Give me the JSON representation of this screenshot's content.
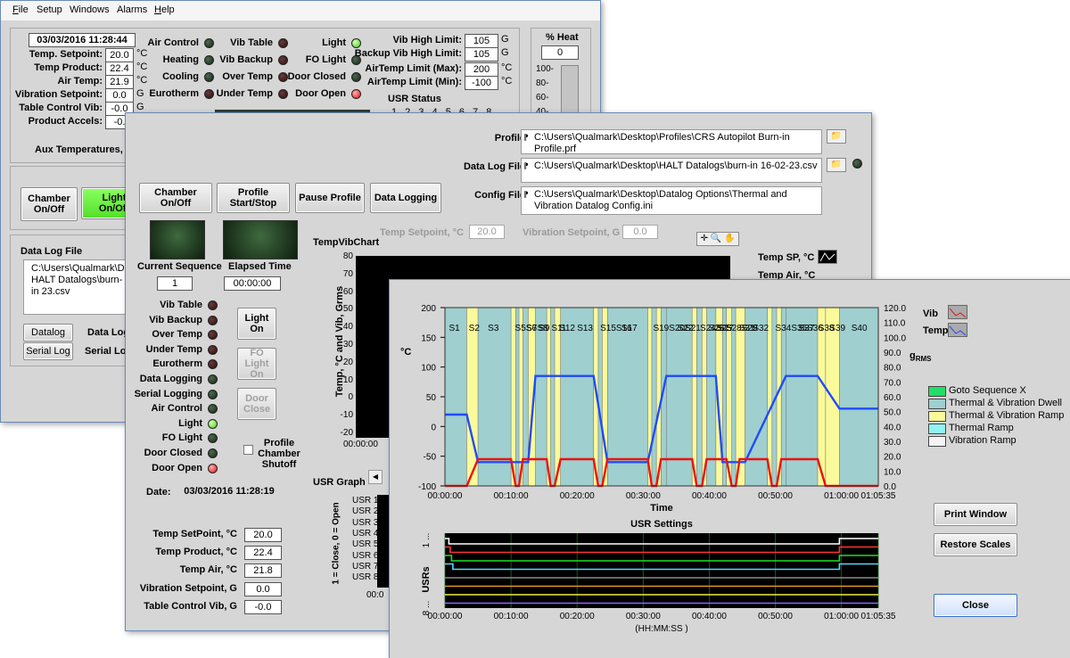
{
  "win1": {
    "menu": [
      "File",
      "Setup",
      "Windows",
      "Alarms",
      "Help"
    ],
    "datetime": "03/03/2016 11:28:44",
    "readouts": [
      {
        "label": "Temp. Setpoint:",
        "value": "20.0",
        "unit": "°C"
      },
      {
        "label": "Temp Product:",
        "value": "22.4",
        "unit": "°C"
      },
      {
        "label": "Air Temp:",
        "value": "21.9",
        "unit": "°C"
      },
      {
        "label": "Vibration Setpoint:",
        "value": "0.0",
        "unit": "G"
      },
      {
        "label": "Table Control Vib:",
        "value": "-0.0",
        "unit": "G"
      },
      {
        "label": "Product Accels:",
        "value": "-0.",
        "unit": ""
      }
    ],
    "aux_label": "Aux Temperatures, °C",
    "leds_col1": [
      {
        "label": "Air Control",
        "state": "offg"
      },
      {
        "label": "Heating",
        "state": "offg"
      },
      {
        "label": "Cooling",
        "state": "offg"
      },
      {
        "label": "Eurotherm",
        "state": "off"
      }
    ],
    "leds_col2": [
      {
        "label": "Vib Table",
        "state": "off"
      },
      {
        "label": "Vib Backup",
        "state": "off"
      },
      {
        "label": "Over Temp",
        "state": "off"
      },
      {
        "label": "Under Temp",
        "state": "off"
      }
    ],
    "leds_col3": [
      {
        "label": "Light",
        "state": "green"
      },
      {
        "label": "FO Light",
        "state": "offg"
      },
      {
        "label": "Door Closed",
        "state": "offg"
      },
      {
        "label": "Door Open",
        "state": "red"
      }
    ],
    "limits": [
      {
        "label": "Vib High Limit:",
        "value": "105",
        "unit": "G"
      },
      {
        "label": "Backup Vib High Limit:",
        "value": "105",
        "unit": "G"
      },
      {
        "label": "AirTemp Limit (Max):",
        "value": "200",
        "unit": "°C"
      },
      {
        "label": "AirTemp Limit (Min):",
        "value": "-100",
        "unit": "°C"
      }
    ],
    "usr_status": "USR Status",
    "usr_numbers": "1 2 3 4 5 6 7 8",
    "heat_label": "% Heat",
    "heat_value": "0",
    "heat_ticks": [
      "100-",
      "80-",
      "60-",
      "40-"
    ],
    "btn_chamber": "Chamber On/Off",
    "btn_light": "Light On/Off",
    "datalog_title": "Data Log File",
    "datalog_path": "C:\\Users\\Qualmark\\Desk HALT Datalogs\\burn-in 23.csv",
    "btn_datalog": "Datalog",
    "btn_seriallog": "Serial Log",
    "datalog_side": "Data Log",
    "seriallog_side": "Serial Log"
  },
  "win2": {
    "buttons": [
      "Chamber On/Off",
      "Profile Start/Stop",
      "Pause Profile",
      "Data Logging"
    ],
    "profile_label": "Profile",
    "profile_path": "C:\\Users\\Qualmark\\Desktop\\Profiles\\CRS Autopilot Burn-in Profile.prf",
    "datalog_label": "Data Log File",
    "datalog_path": "C:\\Users\\Qualmark\\Desktop\\HALT Datalogs\\burn-in 16-02-23.csv",
    "config_label": "Config File",
    "config_path": "C:\\Users\\Qualmark\\Desktop\\Datalog Options\\Thermal and Vibration Datalog Config.ini",
    "temp_setpoint_label": "Temp Setpoint, °C",
    "temp_setpoint_value": "20.0",
    "vib_setpoint_label": "Vibration Setpoint, G",
    "vib_setpoint_value": "0.0",
    "current_sequence_label": "Current Sequence",
    "current_sequence_value": "1",
    "elapsed_label": "Elapsed Time",
    "elapsed_value": "00:00:00",
    "chart_title": "TempVibChart",
    "chart_ylabel": "Temp, °C and Vib, Grms",
    "chart_yticks": [
      "80",
      "70",
      "60",
      "50",
      "40",
      "30",
      "20",
      "10",
      "0",
      "-10",
      "-20"
    ],
    "chart_xtick": "00:00:00",
    "legend": [
      "Temp SP, °C",
      "Temp Air, °C"
    ],
    "leds": [
      {
        "label": "Vib Table",
        "state": "off"
      },
      {
        "label": "Vib Backup",
        "state": "off"
      },
      {
        "label": "Over Temp",
        "state": "off"
      },
      {
        "label": "Under Temp",
        "state": "off"
      },
      {
        "label": "Eurotherm",
        "state": "off"
      },
      {
        "label": "Data Logging",
        "state": "offg"
      },
      {
        "label": "Serial Logging",
        "state": "offg"
      },
      {
        "label": "Air Control",
        "state": "offg"
      },
      {
        "label": "Light",
        "state": "green"
      },
      {
        "label": "FO Light",
        "state": "offg"
      },
      {
        "label": "Door Closed",
        "state": "offg"
      },
      {
        "label": "Door Open",
        "state": "red"
      }
    ],
    "light_btn": "Light On",
    "fo_light_btn": "FO Light On",
    "door_btn": "Door Close",
    "profile_shutoff": "Profile Chamber Shutoff",
    "date_label": "Date:",
    "date_value": "03/03/2016 11:28:19",
    "readouts": [
      {
        "label": "Temp SetPoint, °C",
        "value": "20.0"
      },
      {
        "label": "Temp Product, °C",
        "value": "22.4"
      },
      {
        "label": "Temp Air, °C",
        "value": "21.8"
      },
      {
        "label": "Vibration Setpoint, G",
        "value": "0.0"
      },
      {
        "label": "Table Control Vib, G",
        "value": "-0.0"
      }
    ],
    "usr_graph_title": "USR Graph",
    "usr_graph_ylabel": "1 = Close, 0 = Open",
    "usr_graph_rows": [
      "USR 1",
      "USR 2",
      "USR 3",
      "USR 4",
      "USR 5",
      "USR 6",
      "USR 7",
      "USR 8"
    ],
    "usr_graph_xtick": "00:0"
  },
  "win3": {
    "y_left_label": "°C",
    "y_right_label_vib": "Vib",
    "y_right_label_temp": "Temp",
    "y_right_unit": "g RMS",
    "x_label": "Time",
    "usr_title": "USR Settings",
    "usr_xlabel": "(HH:MM:SS )",
    "usr_ylabel": "USRs",
    "usr_y_top": "1 ...",
    "usr_y_bottom": "8 ...",
    "legend": [
      {
        "label": "Goto Sequence X",
        "color": "#22dd66"
      },
      {
        "label": "Thermal & Vibration Dwell",
        "color": "#9fcfcf"
      },
      {
        "label": "Thermal & Vibration Ramp",
        "color": "#fafa9a"
      },
      {
        "label": "Thermal Ramp",
        "color": "#90f4f4"
      },
      {
        "label": "Vibration Ramp",
        "color": "#f4f4f4"
      }
    ],
    "btn_print": "Print Window",
    "btn_restore": "Restore Scales",
    "btn_close": "Close"
  },
  "chart_data": [
    {
      "type": "line",
      "title": "",
      "xlabel": "Time",
      "ylabel": "°C",
      "y2label": "g RMS",
      "xlim": [
        "00:00:00",
        "01:05:35"
      ],
      "ylim": [
        -100,
        200
      ],
      "y2lim": [
        0.0,
        120.0
      ],
      "x_ticks": [
        "00:00:00",
        "00:10:00",
        "00:20:00",
        "00:30:00",
        "00:40:00",
        "00:50:00",
        "01:00:00",
        "01:05:35"
      ],
      "y_ticks": [
        "200",
        "150",
        "100",
        "50",
        "0",
        "-50",
        "-100"
      ],
      "y2_ticks": [
        "120.0",
        "110.0",
        "100.0",
        "90.0",
        "80.0",
        "70.0",
        "60.0",
        "50.0",
        "40.0",
        "30.0",
        "20.0",
        "10.0",
        "0.0"
      ],
      "segments": [
        {
          "name": "S1",
          "t0_min": 0,
          "t1_min": 3.3,
          "kind": "dwell"
        },
        {
          "name": "S2",
          "t0_min": 3.3,
          "t1_min": 5.0,
          "kind": "ramp"
        },
        {
          "name": "S3",
          "t0_min": 5.0,
          "t1_min": 10.0,
          "kind": "dwell"
        },
        {
          "name": "S4",
          "t0_min": 10.0,
          "t1_min": 10.7,
          "kind": "ramp"
        },
        {
          "name": "S5",
          "t0_min": 10.7,
          "t1_min": 11.2,
          "kind": "dwell"
        },
        {
          "name": "S6",
          "t0_min": 11.2,
          "t1_min": 11.8,
          "kind": "ramp"
        },
        {
          "name": "S7",
          "t0_min": 11.8,
          "t1_min": 12.6,
          "kind": "dwell"
        },
        {
          "name": "S8",
          "t0_min": 12.6,
          "t1_min": 13.7,
          "kind": "ramp"
        },
        {
          "name": "S9",
          "t0_min": 13.7,
          "t1_min": 15.4,
          "kind": "dwell"
        },
        {
          "name": "S10",
          "t0_min": 15.4,
          "t1_min": 16.0,
          "kind": "ramp"
        },
        {
          "name": "S11",
          "t0_min": 16.0,
          "t1_min": 16.6,
          "kind": "dwell"
        },
        {
          "name": "S12",
          "t0_min": 16.6,
          "t1_min": 17.5,
          "kind": "ramp"
        },
        {
          "name": "S13",
          "t0_min": 17.5,
          "t1_min": 22.5,
          "kind": "dwell"
        },
        {
          "name": "S14",
          "t0_min": 22.5,
          "t1_min": 23.2,
          "kind": "ramp"
        },
        {
          "name": "S15",
          "t0_min": 23.2,
          "t1_min": 23.8,
          "kind": "dwell"
        },
        {
          "name": "S16",
          "t0_min": 23.8,
          "t1_min": 24.6,
          "kind": "ramp"
        },
        {
          "name": "S17",
          "t0_min": 24.6,
          "t1_min": 30.7,
          "kind": "dwell"
        },
        {
          "name": "S18",
          "t0_min": 30.7,
          "t1_min": 31.3,
          "kind": "ramp"
        },
        {
          "name": "S19",
          "t0_min": 31.3,
          "t1_min": 32.0,
          "kind": "dwell"
        },
        {
          "name": "S20",
          "t0_min": 32.0,
          "t1_min": 32.7,
          "kind": "ramp"
        },
        {
          "name": "S21",
          "t0_min": 32.7,
          "t1_min": 33.5,
          "kind": "dwell"
        },
        {
          "name": "S22",
          "t0_min": 33.5,
          "t1_min": 37.4,
          "kind": "dwell"
        },
        {
          "name": "S23",
          "t0_min": 37.4,
          "t1_min": 38.1,
          "kind": "ramp"
        },
        {
          "name": "S24",
          "t0_min": 38.1,
          "t1_min": 38.9,
          "kind": "dwell"
        },
        {
          "name": "S25",
          "t0_min": 38.9,
          "t1_min": 39.6,
          "kind": "ramp"
        },
        {
          "name": "S26",
          "t0_min": 39.6,
          "t1_min": 41.0,
          "kind": "dwell"
        },
        {
          "name": "S27",
          "t0_min": 41.0,
          "t1_min": 42.0,
          "kind": "ramp"
        },
        {
          "name": "S28",
          "t0_min": 42.0,
          "t1_min": 42.6,
          "kind": "dwell"
        },
        {
          "name": "S29",
          "t0_min": 42.6,
          "t1_min": 43.4,
          "kind": "ramp"
        },
        {
          "name": "S30",
          "t0_min": 43.4,
          "t1_min": 44.0,
          "kind": "dwell"
        },
        {
          "name": "S31",
          "t0_min": 44.0,
          "t1_min": 45.4,
          "kind": "ramp"
        },
        {
          "name": "S32",
          "t0_min": 45.4,
          "t1_min": 48.8,
          "kind": "dwell"
        },
        {
          "name": "S33",
          "t0_min": 48.8,
          "t1_min": 49.5,
          "kind": "ramp"
        },
        {
          "name": "S34",
          "t0_min": 49.5,
          "t1_min": 50.2,
          "kind": "dwell"
        },
        {
          "name": "S35",
          "t0_min": 50.2,
          "t1_min": 50.9,
          "kind": "ramp"
        },
        {
          "name": "S36",
          "t0_min": 50.9,
          "t1_min": 51.6,
          "kind": "dwell"
        },
        {
          "name": "S37",
          "t0_min": 51.6,
          "t1_min": 56.4,
          "kind": "dwell"
        },
        {
          "name": "S38",
          "t0_min": 56.4,
          "t1_min": 57.6,
          "kind": "ramp"
        },
        {
          "name": "S39",
          "t0_min": 57.6,
          "t1_min": 59.7,
          "kind": "ramp"
        },
        {
          "name": "S40",
          "t0_min": 59.7,
          "t1_min": 65.58,
          "kind": "dwell"
        }
      ],
      "segment_labels": [
        "S1",
        "S2",
        "S3",
        "S5S6",
        "S7S8",
        "S9",
        "S11",
        "S12",
        "S13",
        "S15S16",
        "S17",
        "S19S20S21",
        "S22",
        "S24S25",
        "S26",
        "S27",
        "S28S29",
        "S31",
        "S32",
        "S34S35S36",
        "S37",
        "S38",
        "S39",
        "S40"
      ],
      "series": [
        {
          "name": "Temp",
          "axis": "left",
          "color": "#1e4bff",
          "points": [
            [
              0,
              20
            ],
            [
              3.3,
              20
            ],
            [
              5.0,
              -60
            ],
            [
              10.0,
              -60
            ],
            [
              10.7,
              -60
            ],
            [
              12.6,
              -60
            ],
            [
              13.7,
              85
            ],
            [
              22.5,
              85
            ],
            [
              24.6,
              -60
            ],
            [
              30.7,
              -60
            ],
            [
              33.5,
              85
            ],
            [
              41.0,
              85
            ],
            [
              42.0,
              -60
            ],
            [
              45.4,
              -60
            ],
            [
              51.6,
              85
            ],
            [
              56.4,
              85
            ],
            [
              59.7,
              30
            ],
            [
              65.58,
              30
            ]
          ]
        },
        {
          "name": "Vib",
          "axis": "right",
          "color": "#ee1111",
          "points": [
            [
              0,
              0
            ],
            [
              3.3,
              0
            ],
            [
              5.0,
              18
            ],
            [
              10.0,
              18
            ],
            [
              10.7,
              0
            ],
            [
              11.2,
              0
            ],
            [
              11.8,
              18
            ],
            [
              12.6,
              18
            ],
            [
              13.7,
              18
            ],
            [
              15.4,
              18
            ],
            [
              16.0,
              0
            ],
            [
              16.6,
              0
            ],
            [
              17.5,
              18
            ],
            [
              22.5,
              18
            ],
            [
              23.2,
              0
            ],
            [
              23.8,
              0
            ],
            [
              24.6,
              18
            ],
            [
              30.7,
              18
            ],
            [
              31.3,
              0
            ],
            [
              32.0,
              0
            ],
            [
              32.7,
              18
            ],
            [
              37.4,
              18
            ],
            [
              38.1,
              0
            ],
            [
              38.9,
              0
            ],
            [
              39.6,
              18
            ],
            [
              42.6,
              18
            ],
            [
              43.4,
              0
            ],
            [
              44.0,
              0
            ],
            [
              44.6,
              18
            ],
            [
              48.8,
              18
            ],
            [
              49.5,
              0
            ],
            [
              50.2,
              0
            ],
            [
              50.9,
              18
            ],
            [
              56.4,
              18
            ],
            [
              57.6,
              0
            ],
            [
              65.58,
              0
            ]
          ]
        }
      ]
    },
    {
      "type": "line",
      "title": "USR Settings",
      "xlabel": "(HH:MM:SS )",
      "ylabel": "USRs",
      "x_ticks": [
        "00:00:00",
        "00:10:00",
        "00:20:00",
        "00:30:00",
        "00:40:00",
        "00:50:00",
        "01:00:00",
        "01:05:35"
      ],
      "series": [
        {
          "name": "USR 1",
          "color": "#ffffff",
          "steps": [
            [
              0,
              1
            ],
            [
              0.6,
              0
            ],
            [
              59.7,
              1
            ]
          ]
        },
        {
          "name": "USR 2",
          "color": "#ff3333",
          "steps": [
            [
              0,
              1
            ],
            [
              0.8,
              0
            ],
            [
              59.7,
              1
            ]
          ]
        },
        {
          "name": "USR 3",
          "color": "#22dd22",
          "steps": [
            [
              0,
              1
            ],
            [
              1.0,
              0
            ],
            [
              59.7,
              1
            ]
          ]
        },
        {
          "name": "USR 4",
          "color": "#55d8f8",
          "steps": [
            [
              0,
              1
            ],
            [
              1.2,
              0
            ],
            [
              59.7,
              1
            ]
          ]
        },
        {
          "name": "USR 5",
          "color": "#8a8a8a",
          "steps": [
            [
              0,
              0
            ]
          ]
        },
        {
          "name": "USR 6",
          "color": "#dd9922",
          "steps": [
            [
              0,
              0
            ]
          ]
        },
        {
          "name": "USR 7",
          "color": "#eeee44",
          "steps": [
            [
              0,
              0
            ]
          ]
        },
        {
          "name": "USR 8",
          "color": "#8866ff",
          "steps": [
            [
              0,
              0
            ]
          ]
        }
      ]
    }
  ]
}
